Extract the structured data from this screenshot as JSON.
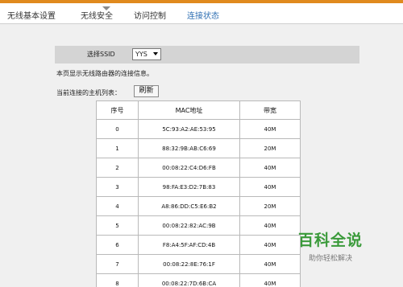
{
  "nav": {
    "tabs": [
      {
        "label": "无线基本设置",
        "active": false
      },
      {
        "label": "无线安全",
        "active": false
      },
      {
        "label": "访问控制",
        "active": false
      },
      {
        "label": "连接状态",
        "active": true
      }
    ]
  },
  "ssid": {
    "label": "选择SSID",
    "selected": "YYS"
  },
  "info_text": "本页显示无线路由器的连接信息。",
  "hosts": {
    "list_label": "当前连接的主机列表：",
    "refresh_label": "刷新",
    "headers": [
      "序号",
      "MAC地址",
      "带宽"
    ],
    "rows": [
      [
        "0",
        "5C:93:A2:AE:53:95",
        "40M"
      ],
      [
        "1",
        "88:32:9B:AB:C6:69",
        "20M"
      ],
      [
        "2",
        "00:08:22:C4:D6:FB",
        "40M"
      ],
      [
        "3",
        "98:FA:E3:D2:7B:83",
        "40M"
      ],
      [
        "4",
        "A8:86:DD:C5:E6:B2",
        "20M"
      ],
      [
        "5",
        "00:08:22:82:AC:9B",
        "40M"
      ],
      [
        "6",
        "F8:A4:5F:AF:CD:4B",
        "40M"
      ],
      [
        "7",
        "00:08:22:8E:76:1F",
        "40M"
      ],
      [
        "8",
        "00:08:22:7D:6B:CA",
        "40M"
      ]
    ]
  },
  "watermark": {
    "title": "百科全说",
    "subtitle": "助你轻松解决"
  },
  "colors": {
    "accent": "#e08a1e",
    "active_tab": "#2f6fb3",
    "watermark": "#3a9a3a"
  }
}
